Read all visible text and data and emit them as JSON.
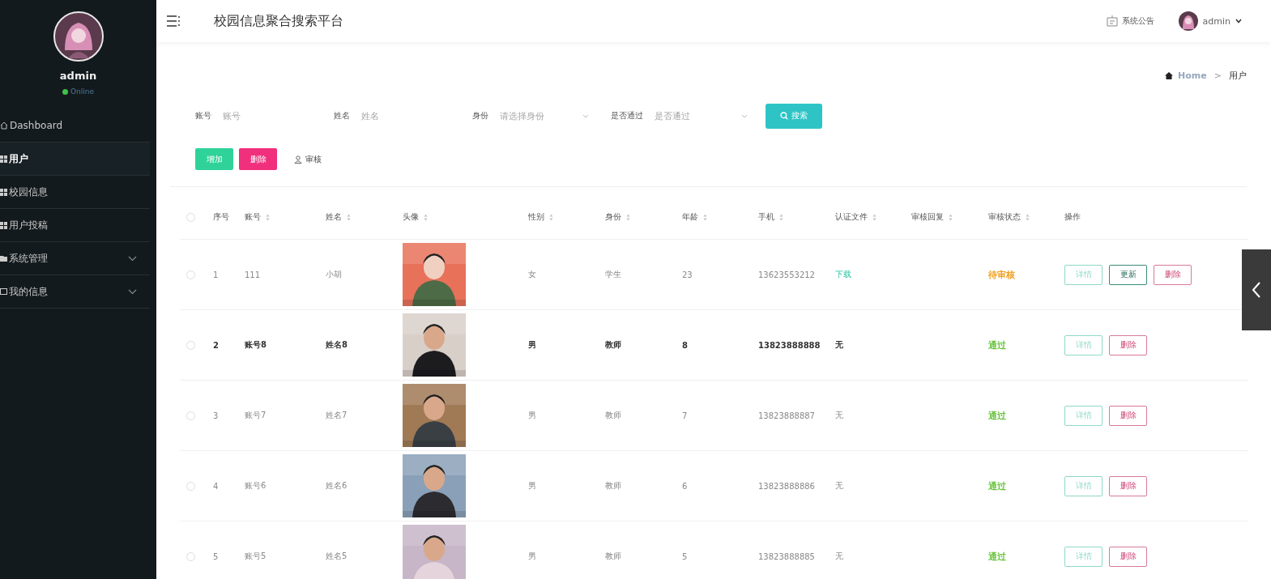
{
  "sidebar": {
    "user": {
      "name": "admin",
      "status": "Online",
      "online": true
    },
    "items": [
      {
        "label": "Dashboard",
        "kind": "home",
        "selected": false,
        "expandable": false
      },
      {
        "label": "用户",
        "kind": "grid",
        "selected": true,
        "expandable": false
      },
      {
        "label": "校园信息",
        "kind": "grid",
        "selected": false,
        "expandable": false
      },
      {
        "label": "用户投稿",
        "kind": "grid",
        "selected": false,
        "expandable": false
      },
      {
        "label": "系统管理",
        "kind": "folder",
        "selected": false,
        "expandable": true
      },
      {
        "label": "我的信息",
        "kind": "card",
        "selected": false,
        "expandable": true
      }
    ]
  },
  "header": {
    "title": "校园信息聚合搜索平台",
    "notice": "系统公告",
    "user": "admin"
  },
  "breadcrumb": {
    "home": "Home",
    "separator": ">",
    "current": "用户"
  },
  "filters": [
    {
      "label": "账号",
      "placeholder": "账号",
      "kind": "input"
    },
    {
      "label": "姓名",
      "placeholder": "姓名",
      "kind": "input"
    },
    {
      "label": "身份",
      "placeholder": "请选择身份",
      "kind": "select"
    },
    {
      "label": "是否通过",
      "placeholder": "是否通过",
      "kind": "select"
    }
  ],
  "search_button": "搜索",
  "actions": [
    {
      "label": "增加",
      "kind": "add"
    },
    {
      "label": "删除",
      "kind": "delete"
    },
    {
      "label": "审核",
      "kind": "review"
    }
  ],
  "table": {
    "all_checked": false,
    "columns": [
      {
        "label": "序号",
        "sortable": false
      },
      {
        "label": "账号",
        "sortable": true
      },
      {
        "label": "姓名",
        "sortable": true
      },
      {
        "label": "头像",
        "sortable": true
      },
      {
        "label": "性别",
        "sortable": true
      },
      {
        "label": "身份",
        "sortable": true
      },
      {
        "label": "年龄",
        "sortable": true
      },
      {
        "label": "手机",
        "sortable": true
      },
      {
        "label": "认证文件",
        "sortable": true
      },
      {
        "label": "审核回复",
        "sortable": true
      },
      {
        "label": "审核状态",
        "sortable": true
      },
      {
        "label": "操作",
        "sortable": false
      }
    ],
    "rows": [
      {
        "checked": false,
        "index": "1",
        "account": "111",
        "name": "小胡",
        "avatar": {
          "kind": "picture"
        },
        "gender": "女",
        "role": "学生",
        "age": "23",
        "phone": "13623553212",
        "file": {
          "text": "下载",
          "kind": "link"
        },
        "status": {
          "text": "待审核",
          "color": "#f0a020"
        },
        "highlighted": false,
        "buttons": [
          {
            "label": "详情",
            "kind": "detail"
          },
          {
            "label": "更新",
            "kind": "update"
          },
          {
            "label": "删除",
            "kind": "delete"
          }
        ]
      },
      {
        "checked": false,
        "index": "2",
        "account": "账号8",
        "name": "姓名8",
        "avatar": {
          "kind": "picture"
        },
        "gender": "男",
        "role": "教师",
        "age": "8",
        "phone": "13823888888",
        "file": {
          "text": "无",
          "kind": "none"
        },
        "status": {
          "text": "通过",
          "color": "#67c23a"
        },
        "highlighted": true,
        "buttons": [
          {
            "label": "详情",
            "kind": "detail"
          },
          {
            "label": "删除",
            "kind": "delete"
          }
        ]
      },
      {
        "checked": false,
        "index": "3",
        "account": "账号7",
        "name": "姓名7",
        "avatar": {
          "kind": "picture"
        },
        "gender": "男",
        "role": "教师",
        "age": "7",
        "phone": "13823888887",
        "file": {
          "text": "无",
          "kind": "none"
        },
        "status": {
          "text": "通过",
          "color": "#67c23a"
        },
        "highlighted": false,
        "buttons": [
          {
            "label": "详情",
            "kind": "detail"
          },
          {
            "label": "删除",
            "kind": "delete"
          }
        ]
      },
      {
        "checked": false,
        "index": "4",
        "account": "账号6",
        "name": "姓名6",
        "avatar": {
          "kind": "picture"
        },
        "gender": "男",
        "role": "教师",
        "age": "6",
        "phone": "13823888886",
        "file": {
          "text": "无",
          "kind": "none"
        },
        "status": {
          "text": "通过",
          "color": "#67c23a"
        },
        "highlighted": false,
        "buttons": [
          {
            "label": "详情",
            "kind": "detail"
          },
          {
            "label": "删除",
            "kind": "delete"
          }
        ]
      },
      {
        "checked": false,
        "index": "5",
        "account": "账号5",
        "name": "姓名5",
        "avatar": {
          "kind": "picture"
        },
        "gender": "男",
        "role": "教师",
        "age": "5",
        "phone": "13823888885",
        "file": {
          "text": "无",
          "kind": "none"
        },
        "status": {
          "text": "通过",
          "color": "#67c23a"
        },
        "highlighted": false,
        "buttons": [
          {
            "label": "详情",
            "kind": "detail"
          },
          {
            "label": "删除",
            "kind": "delete"
          }
        ]
      }
    ]
  }
}
